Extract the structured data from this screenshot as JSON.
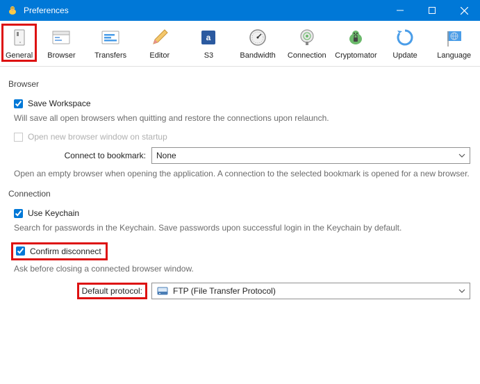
{
  "window": {
    "title": "Preferences"
  },
  "toolbar": {
    "items": [
      {
        "label": "General"
      },
      {
        "label": "Browser"
      },
      {
        "label": "Transfers"
      },
      {
        "label": "Editor"
      },
      {
        "label": "S3"
      },
      {
        "label": "Bandwidth"
      },
      {
        "label": "Connection"
      },
      {
        "label": "Cryptomator"
      },
      {
        "label": "Update"
      },
      {
        "label": "Language"
      }
    ]
  },
  "browser_section": {
    "heading": "Browser",
    "save_workspace_label": "Save Workspace",
    "save_workspace_checked": true,
    "save_workspace_desc": "Will save all open browsers when quitting and restore the connections upon relaunch.",
    "open_new_label": "Open new browser window on startup",
    "connect_bookmark_label": "Connect to bookmark:",
    "connect_bookmark_value": "None",
    "connect_bookmark_desc": "Open an empty browser when opening the application. A connection to the selected bookmark is opened for a new browser."
  },
  "connection_section": {
    "heading": "Connection",
    "use_keychain_label": "Use Keychain",
    "use_keychain_checked": true,
    "use_keychain_desc": "Search for passwords in the Keychain. Save passwords upon successful login in the Keychain by default.",
    "confirm_disconnect_label": "Confirm disconnect",
    "confirm_disconnect_checked": true,
    "confirm_disconnect_desc": "Ask before closing a connected browser window.",
    "default_protocol_label": "Default protocol:",
    "default_protocol_value": "FTP (File Transfer Protocol)"
  }
}
